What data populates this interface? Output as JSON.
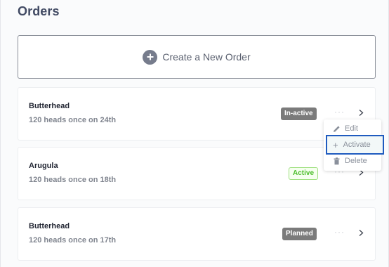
{
  "page": {
    "title": "Orders"
  },
  "create": {
    "label": "Create a New Order",
    "icon": "plus-circle-icon"
  },
  "orders": [
    {
      "name": "Butterhead",
      "schedule": "120 heads once on 24th",
      "status": "In-active"
    },
    {
      "name": "Arugula",
      "schedule": "120 heads once on 18th",
      "status": "Active"
    },
    {
      "name": "Butterhead",
      "schedule": "120 heads once on 17th",
      "status": "Planned"
    }
  ],
  "menu": {
    "edit": "Edit",
    "activate": "Activate",
    "delete": "Delete"
  },
  "colors": {
    "title": "#414a63",
    "badge_dark": "#7b7b7b",
    "badge_active_text": "#4bbd2a",
    "focus_outline": "#1f5bbf"
  }
}
